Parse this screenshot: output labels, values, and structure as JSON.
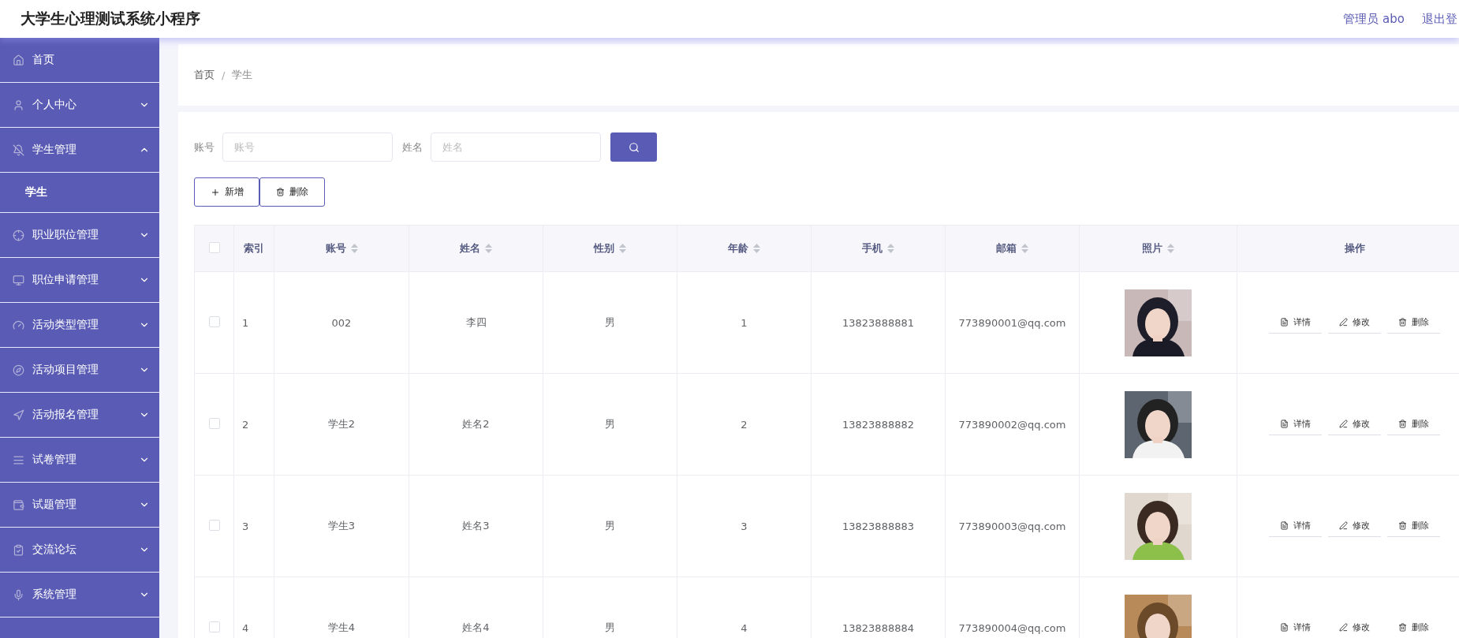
{
  "header": {
    "title": "大学生心理测试系统小程序",
    "user": "管理员 abo",
    "logout": "退出登"
  },
  "sidebar": {
    "items": [
      {
        "label": "首页",
        "kind": "link"
      },
      {
        "label": "个人中心",
        "kind": "menu",
        "expanded": false
      },
      {
        "label": "学生管理",
        "kind": "menu",
        "expanded": true,
        "children": [
          {
            "label": "学生",
            "selected": true
          }
        ]
      },
      {
        "label": "职业职位管理",
        "kind": "menu",
        "expanded": false
      },
      {
        "label": "职位申请管理",
        "kind": "menu",
        "expanded": false
      },
      {
        "label": "活动类型管理",
        "kind": "menu",
        "expanded": false
      },
      {
        "label": "活动项目管理",
        "kind": "menu",
        "expanded": false
      },
      {
        "label": "活动报名管理",
        "kind": "menu",
        "expanded": false
      },
      {
        "label": "试卷管理",
        "kind": "menu",
        "expanded": false
      },
      {
        "label": "试题管理",
        "kind": "menu",
        "expanded": false
      },
      {
        "label": "交流论坛",
        "kind": "menu",
        "expanded": false
      },
      {
        "label": "系统管理",
        "kind": "menu",
        "expanded": false
      }
    ]
  },
  "breadcrumb": {
    "items": [
      "首页",
      "学生"
    ],
    "separator": "/"
  },
  "search": {
    "fields": [
      {
        "label": "账号",
        "placeholder": "账号"
      },
      {
        "label": "姓名",
        "placeholder": "姓名"
      }
    ]
  },
  "buttons": [
    {
      "kind": "add",
      "label": "新增"
    },
    {
      "kind": "delete",
      "label": "删除"
    }
  ],
  "table": {
    "columns": [
      {
        "label": "索引",
        "sortable": false
      },
      {
        "label": "账号",
        "sortable": true
      },
      {
        "label": "姓名",
        "sortable": true
      },
      {
        "label": "性别",
        "sortable": true
      },
      {
        "label": "年龄",
        "sortable": true
      },
      {
        "label": "手机",
        "sortable": true
      },
      {
        "label": "邮箱",
        "sortable": true
      },
      {
        "label": "照片",
        "sortable": true
      },
      {
        "label": "操作",
        "sortable": false
      }
    ],
    "header_checked": false,
    "rows": [
      {
        "checked": false,
        "cells": [
          "1",
          "002",
          "李四",
          "男",
          "1",
          "13823888881",
          "773890001@qq.com"
        ],
        "photo": {
          "kind": "picture"
        },
        "actions": [
          {
            "kind": "detail",
            "label": "详情"
          },
          {
            "kind": "edit",
            "label": "修改"
          },
          {
            "kind": "delete",
            "label": "删除"
          }
        ]
      },
      {
        "checked": false,
        "cells": [
          "2",
          "学生2",
          "姓名2",
          "男",
          "2",
          "13823888882",
          "773890002@qq.com"
        ],
        "photo": {
          "kind": "picture"
        },
        "actions": [
          {
            "kind": "detail",
            "label": "详情"
          },
          {
            "kind": "edit",
            "label": "修改"
          },
          {
            "kind": "delete",
            "label": "删除"
          }
        ]
      },
      {
        "checked": false,
        "cells": [
          "3",
          "学生3",
          "姓名3",
          "男",
          "3",
          "13823888883",
          "773890003@qq.com"
        ],
        "photo": {
          "kind": "picture"
        },
        "actions": [
          {
            "kind": "detail",
            "label": "详情"
          },
          {
            "kind": "edit",
            "label": "修改"
          },
          {
            "kind": "delete",
            "label": "删除"
          }
        ]
      },
      {
        "checked": false,
        "cells": [
          "4",
          "学生4",
          "姓名4",
          "男",
          "4",
          "13823888884",
          "773890004@qq.com"
        ],
        "photo": {
          "kind": "picture"
        },
        "actions": [
          {
            "kind": "detail",
            "label": "详情"
          },
          {
            "kind": "edit",
            "label": "修改"
          },
          {
            "kind": "delete",
            "label": "删除"
          }
        ]
      }
    ]
  }
}
